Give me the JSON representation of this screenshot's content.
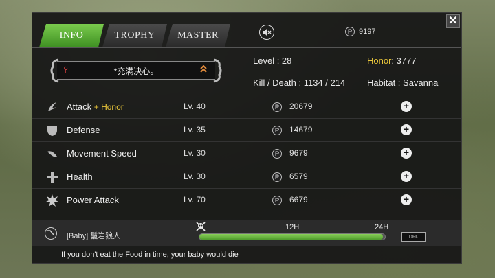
{
  "tabs": [
    {
      "label": "INFO",
      "active": true
    },
    {
      "label": "TROPHY",
      "active": false
    },
    {
      "label": "MASTER",
      "active": false
    }
  ],
  "close_label": "✕",
  "currency": {
    "icon": "coin-p-icon",
    "amount": "9197"
  },
  "profile": {
    "name": "*充满决心。",
    "level_label": "Level : ",
    "level_value": "28",
    "honor_label": "Honor",
    "honor_value": ": 3777",
    "kd_label": "Kill / Death : ",
    "kd_value": "1134 / 214",
    "habitat_label": "Habitat : ",
    "habitat_value": "Savanna"
  },
  "skills": [
    {
      "name": "Attack",
      "bonus": "+ Honor",
      "level": "Lv. 40",
      "price": "20679",
      "icon": "claw-icon"
    },
    {
      "name": "Defense",
      "bonus": "",
      "level": "Lv. 35",
      "price": "14679",
      "icon": "shield-icon"
    },
    {
      "name": "Movement Speed",
      "bonus": "",
      "level": "Lv. 30",
      "price": "9679",
      "icon": "feather-icon"
    },
    {
      "name": "Health",
      "bonus": "",
      "level": "Lv. 30",
      "price": "6579",
      "icon": "cross-icon"
    },
    {
      "name": "Power Attack",
      "bonus": "",
      "level": "Lv. 70",
      "price": "6679",
      "icon": "burst-icon"
    }
  ],
  "baby": {
    "name": "[Baby]  鬣岩狼人",
    "label_12h": "12H",
    "label_24h": "24H",
    "hunger_fraction": 0.99,
    "del_label": "DEL"
  },
  "warning": "If you don't eat the Food in time, your baby would die",
  "colors": {
    "accent_green": "#4e9b2c",
    "honor_gold": "#e8c53a",
    "gender_red": "#e44444"
  }
}
